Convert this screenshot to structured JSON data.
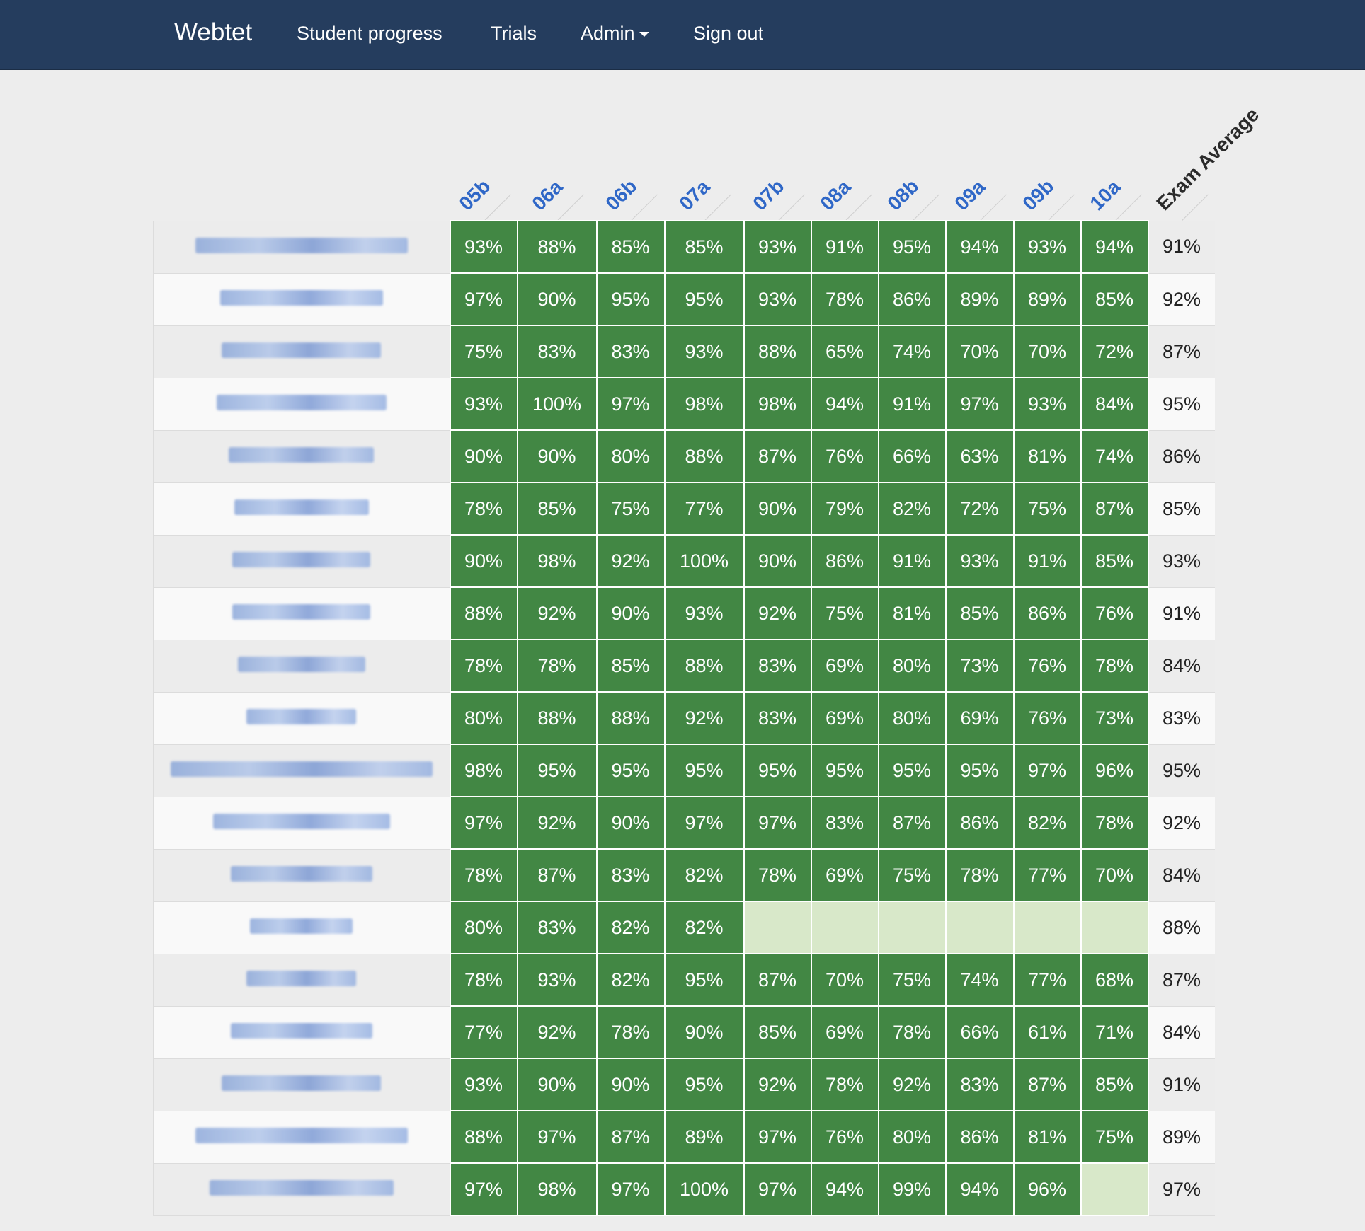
{
  "navbar": {
    "brand": "Webtet",
    "links": [
      "Student progress",
      "Trials",
      "Admin",
      "Sign out"
    ]
  },
  "columns": [
    "05b",
    "06a",
    "06b",
    "07a",
    "07b",
    "08a",
    "08b",
    "09a",
    "09b",
    "10a"
  ],
  "average_header": "Exam Average",
  "rows": [
    {
      "name_width": 300,
      "scores": [
        "93%",
        "88%",
        "85%",
        "85%",
        "93%",
        "91%",
        "95%",
        "94%",
        "93%",
        "94%"
      ],
      "avg": "91%"
    },
    {
      "name_width": 230,
      "scores": [
        "97%",
        "90%",
        "95%",
        "95%",
        "93%",
        "78%",
        "86%",
        "89%",
        "89%",
        "85%"
      ],
      "avg": "92%"
    },
    {
      "name_width": 225,
      "scores": [
        "75%",
        "83%",
        "83%",
        "93%",
        "88%",
        "65%",
        "74%",
        "70%",
        "70%",
        "72%"
      ],
      "avg": "87%"
    },
    {
      "name_width": 240,
      "scores": [
        "93%",
        "100%",
        "97%",
        "98%",
        "98%",
        "94%",
        "91%",
        "97%",
        "93%",
        "84%"
      ],
      "avg": "95%"
    },
    {
      "name_width": 205,
      "scores": [
        "90%",
        "90%",
        "80%",
        "88%",
        "87%",
        "76%",
        "66%",
        "63%",
        "81%",
        "74%"
      ],
      "avg": "86%"
    },
    {
      "name_width": 190,
      "scores": [
        "78%",
        "85%",
        "75%",
        "77%",
        "90%",
        "79%",
        "82%",
        "72%",
        "75%",
        "87%"
      ],
      "avg": "85%"
    },
    {
      "name_width": 195,
      "scores": [
        "90%",
        "98%",
        "92%",
        "100%",
        "90%",
        "86%",
        "91%",
        "93%",
        "91%",
        "85%"
      ],
      "avg": "93%"
    },
    {
      "name_width": 195,
      "scores": [
        "88%",
        "92%",
        "90%",
        "93%",
        "92%",
        "75%",
        "81%",
        "85%",
        "86%",
        "76%"
      ],
      "avg": "91%"
    },
    {
      "name_width": 180,
      "scores": [
        "78%",
        "78%",
        "85%",
        "88%",
        "83%",
        "69%",
        "80%",
        "73%",
        "76%",
        "78%"
      ],
      "avg": "84%"
    },
    {
      "name_width": 155,
      "scores": [
        "80%",
        "88%",
        "88%",
        "92%",
        "83%",
        "69%",
        "80%",
        "69%",
        "76%",
        "73%"
      ],
      "avg": "83%"
    },
    {
      "name_width": 370,
      "scores": [
        "98%",
        "95%",
        "95%",
        "95%",
        "95%",
        "95%",
        "95%",
        "95%",
        "97%",
        "96%"
      ],
      "avg": "95%"
    },
    {
      "name_width": 250,
      "scores": [
        "97%",
        "92%",
        "90%",
        "97%",
        "97%",
        "83%",
        "87%",
        "86%",
        "82%",
        "78%"
      ],
      "avg": "92%"
    },
    {
      "name_width": 200,
      "scores": [
        "78%",
        "87%",
        "83%",
        "82%",
        "78%",
        "69%",
        "75%",
        "78%",
        "77%",
        "70%"
      ],
      "avg": "84%"
    },
    {
      "name_width": 145,
      "scores": [
        "80%",
        "83%",
        "82%",
        "82%",
        "",
        "",
        "",
        "",
        "",
        ""
      ],
      "avg": "88%"
    },
    {
      "name_width": 155,
      "scores": [
        "78%",
        "93%",
        "82%",
        "95%",
        "87%",
        "70%",
        "75%",
        "74%",
        "77%",
        "68%"
      ],
      "avg": "87%"
    },
    {
      "name_width": 200,
      "scores": [
        "77%",
        "92%",
        "78%",
        "90%",
        "85%",
        "69%",
        "78%",
        "66%",
        "61%",
        "71%"
      ],
      "avg": "84%"
    },
    {
      "name_width": 225,
      "scores": [
        "93%",
        "90%",
        "90%",
        "95%",
        "92%",
        "78%",
        "92%",
        "83%",
        "87%",
        "85%"
      ],
      "avg": "91%"
    },
    {
      "name_width": 300,
      "scores": [
        "88%",
        "97%",
        "87%",
        "89%",
        "97%",
        "76%",
        "80%",
        "86%",
        "81%",
        "75%"
      ],
      "avg": "89%"
    },
    {
      "name_width": 260,
      "scores": [
        "97%",
        "98%",
        "97%",
        "100%",
        "97%",
        "94%",
        "99%",
        "94%",
        "96%",
        ""
      ],
      "avg": "97%"
    }
  ]
}
